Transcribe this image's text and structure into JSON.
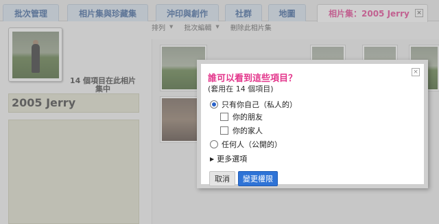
{
  "tabs": [
    {
      "label": "批次管理"
    },
    {
      "label": "相片集與珍藏集"
    },
    {
      "label": "沖印與創作"
    },
    {
      "label": "社群"
    },
    {
      "label": "地圖"
    },
    {
      "label": "相片集：2005 Jerry",
      "close_icon": "close-icon",
      "active": true
    }
  ],
  "album": {
    "count_text": "14 個項目在此相片集中",
    "title": "2005 Jerry"
  },
  "toolbar": {
    "sort_label": "排列",
    "batch_edit_label": "批次編輯",
    "delete_album_label": "刪除此相片集"
  },
  "dialog": {
    "title": "誰可以看到這些項目？",
    "subtitle": "(套用在 14 個項目)",
    "options": {
      "only_me": "只有你自己（私人的）",
      "friends": "你的朋友",
      "family": "你的家人",
      "anyone": "任何人（公開的）"
    },
    "more_options": "更多選項",
    "cancel_label": "取消",
    "change_label": "變更權限",
    "close_glyph": "×"
  },
  "colors": {
    "accent_pink": "#e3358b",
    "tab_blue": "#2f5a97",
    "button_blue": "#2e73d6"
  }
}
